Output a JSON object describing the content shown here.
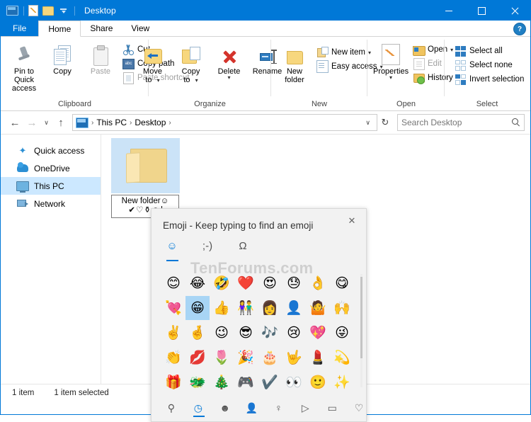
{
  "window": {
    "title": "Desktop",
    "quick_access_icons": [
      "explorer-icon",
      "properties-icon",
      "new-folder-icon",
      "customize-chevron-icon"
    ],
    "minimize": "–",
    "maximize": "□",
    "close": "✕"
  },
  "ribbon": {
    "help_label": "?",
    "tabs": [
      {
        "label": "File",
        "kind": "file"
      },
      {
        "label": "Home",
        "kind": "active"
      },
      {
        "label": "Share",
        "kind": "normal"
      },
      {
        "label": "View",
        "kind": "normal"
      }
    ],
    "groups": [
      {
        "label": "Clipboard",
        "big": [
          {
            "label_line1": "Pin to Quick",
            "label_line2": "access",
            "icon": "pin-icon"
          },
          {
            "label_line1": "Copy",
            "label_line2": "",
            "icon": "copy-icon"
          },
          {
            "label_line1": "Paste",
            "label_line2": "",
            "icon": "paste-icon",
            "disabled": true
          }
        ],
        "small": [
          {
            "label": "Cut",
            "icon": "scissors-icon"
          },
          {
            "label": "Copy path",
            "icon": "copy-path-icon"
          },
          {
            "label": "Paste shortcut",
            "icon": "paste-shortcut-icon",
            "disabled": true
          }
        ]
      },
      {
        "label": "Organize",
        "big": [
          {
            "label_line1": "Move",
            "label_line2": "to",
            "icon": "move-to-icon",
            "caret": true
          },
          {
            "label_line1": "Copy",
            "label_line2": "to",
            "icon": "copy-to-icon",
            "caret": true
          },
          {
            "label_line1": "Delete",
            "label_line2": "",
            "icon": "delete-icon",
            "caret_below": true
          },
          {
            "label_line1": "Rename",
            "label_line2": "",
            "icon": "rename-icon"
          }
        ],
        "small": []
      },
      {
        "label": "New",
        "big": [
          {
            "label_line1": "New",
            "label_line2": "folder",
            "icon": "new-folder-icon"
          }
        ],
        "small": [
          {
            "label": "New item",
            "icon": "new-item-icon",
            "caret": true
          },
          {
            "label": "Easy access",
            "icon": "easy-access-icon",
            "caret": true
          }
        ]
      },
      {
        "label": "Open",
        "big": [
          {
            "label_line1": "Properties",
            "label_line2": "",
            "icon": "properties-icon",
            "caret_below": true
          }
        ],
        "small": [
          {
            "label": "Open",
            "icon": "open-icon",
            "caret": true
          },
          {
            "label": "Edit",
            "icon": "edit-icon",
            "disabled": true
          },
          {
            "label": "History",
            "icon": "history-icon"
          }
        ]
      },
      {
        "label": "Select",
        "big": [],
        "small": [
          {
            "label": "Select all",
            "icon": "select-all-icon"
          },
          {
            "label": "Select none",
            "icon": "select-none-icon"
          },
          {
            "label": "Invert selection",
            "icon": "invert-selection-icon"
          }
        ]
      }
    ]
  },
  "address": {
    "back": "←",
    "forward": "→",
    "recent": "∨",
    "up": "↑",
    "crumbs": [
      "This PC",
      "Desktop"
    ],
    "crumb_sep": "›",
    "dropdown": "∨",
    "refresh": "↻",
    "search_placeholder": "Search Desktop"
  },
  "navpane": {
    "items": [
      {
        "label": "Quick access",
        "icon": "star-icon"
      },
      {
        "label": "OneDrive",
        "icon": "cloud-icon"
      },
      {
        "label": "This PC",
        "icon": "pc-icon",
        "selected": true
      },
      {
        "label": "Network",
        "icon": "network-icon"
      }
    ]
  },
  "file_item": {
    "icon": "folder-icon",
    "rename_line1": "New folder☺",
    "rename_line2": "✔♡⚱☺"
  },
  "emoji_panel": {
    "title": "Emoji - Keep typing to find an emoji",
    "close": "✕",
    "tabs": [
      {
        "label": "☺",
        "name": "tab-emoji",
        "active": true
      },
      {
        "label": ";-)",
        "name": "tab-kaomoji",
        "active": false
      },
      {
        "label": "Ω",
        "name": "tab-symbols",
        "active": false
      }
    ],
    "rows": [
      [
        "😊",
        "😂",
        "🤣",
        "❤️",
        "😍",
        "😓",
        "👌",
        "😋"
      ],
      [
        "💘",
        "😁",
        "👍",
        "👫",
        "👩",
        "👤",
        "🤷",
        "🙌"
      ],
      [
        "✌️",
        "🤞",
        "😉",
        "😎",
        "🎶",
        "😢",
        "💖",
        "😜"
      ],
      [
        "👏",
        "💋",
        "🌷",
        "🎉",
        "🎂",
        "🤟",
        "💄",
        "💫"
      ],
      [
        "🎁",
        "🐲",
        "🎄",
        "🎮",
        "✔️",
        "👀",
        "🙂",
        "✨"
      ]
    ],
    "selected_cell": {
      "row": 1,
      "col": 1
    },
    "footer_categories": [
      {
        "icon": "search-icon",
        "glyph": "⚲",
        "active": false
      },
      {
        "icon": "recent-clock-icon",
        "glyph": "◷",
        "active": true
      },
      {
        "icon": "smiley-icon",
        "glyph": "☻",
        "active": false
      },
      {
        "icon": "people-icon",
        "glyph": "👤",
        "active": false
      },
      {
        "icon": "celebration-icon",
        "glyph": "♀",
        "active": false
      },
      {
        "icon": "food-icon",
        "glyph": "▷",
        "active": false
      },
      {
        "icon": "transport-icon",
        "glyph": "▭",
        "active": false
      },
      {
        "icon": "symbols-heart-icon",
        "glyph": "♡",
        "active": false
      }
    ]
  },
  "watermark": "TenForums.com",
  "statusbar": {
    "item_count": "1 item",
    "selection": "1 item selected"
  }
}
